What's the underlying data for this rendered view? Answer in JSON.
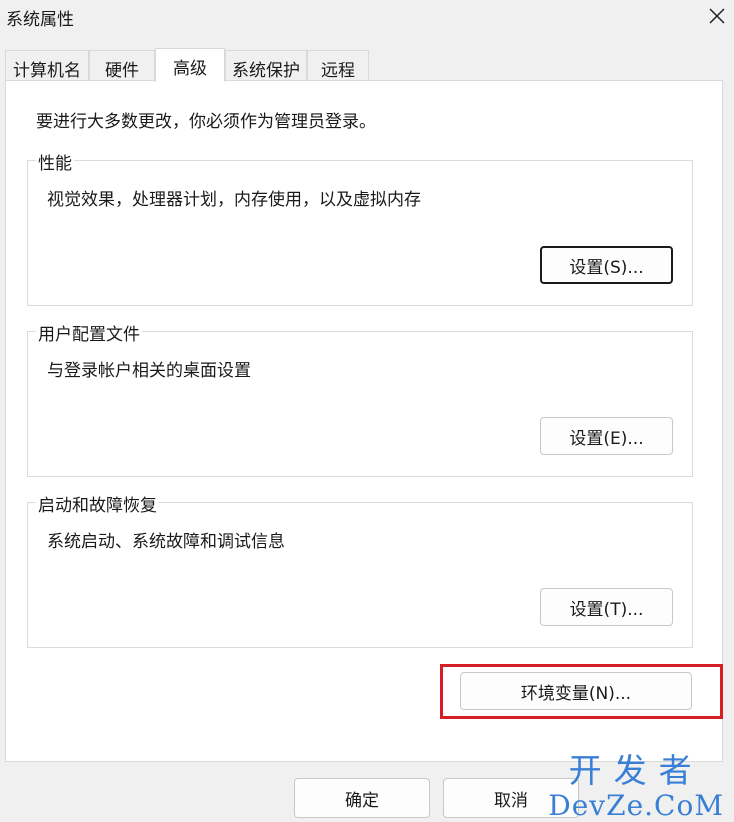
{
  "window": {
    "title": "系统属性",
    "close_icon": "close-icon"
  },
  "tabs": [
    {
      "label": "计算机名",
      "active": false
    },
    {
      "label": "硬件",
      "active": false
    },
    {
      "label": "高级",
      "active": true
    },
    {
      "label": "系统保护",
      "active": false
    },
    {
      "label": "远程",
      "active": false
    }
  ],
  "intro": "要进行大多数更改，你必须作为管理员登录。",
  "groups": {
    "performance": {
      "title": "性能",
      "desc": "视觉效果，处理器计划，内存使用，以及虚拟内存",
      "button": "设置(S)..."
    },
    "user_profiles": {
      "title": "用户配置文件",
      "desc": "与登录帐户相关的桌面设置",
      "button": "设置(E)..."
    },
    "startup_recovery": {
      "title": "启动和故障恢复",
      "desc": "系统启动、系统故障和调试信息",
      "button": "设置(T)..."
    }
  },
  "env_button": "环境变量(N)...",
  "footer": {
    "ok": "确定",
    "cancel": "取消"
  },
  "watermark": {
    "top": "开发者",
    "bottom": "DevZe.CoM"
  },
  "colors": {
    "highlight": "#d61f25",
    "watermark": "#3a7fd6"
  }
}
